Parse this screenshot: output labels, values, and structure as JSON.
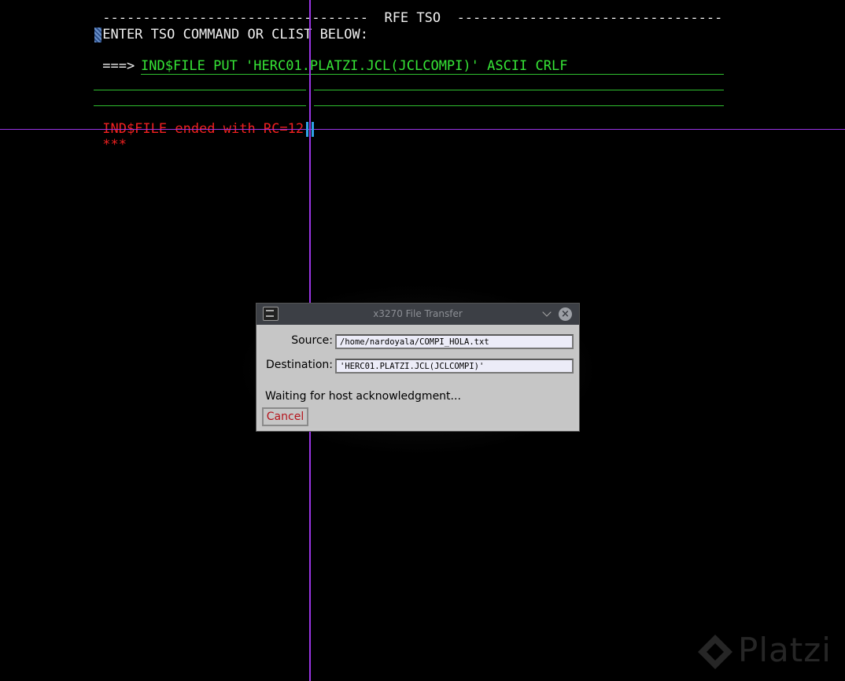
{
  "terminal": {
    "header_line": " ---------------------------------  RFE TSO  ---------------------------------",
    "prompt_line": " ENTER TSO COMMAND OR CLIST BELOW:",
    "arrow": " ===> ",
    "command": "IND$FILE PUT 'HERC01.PLATZI.JCL(JCLCOMPI)' ASCII CRLF",
    "message": " IND$FILE ended with RC=12",
    "asterisks": " ***"
  },
  "dialog": {
    "title": "x3270 File Transfer",
    "source_label": "Source:",
    "source_value": "/home/nardoyala/COMPI_HOLA.txt",
    "destination_label": "Destination:",
    "destination_value": "'HERC01.PLATZI.JCL(JCLCOMPI)'",
    "status": "Waiting for host acknowledgment...",
    "cancel_label": "Cancel"
  },
  "watermark": {
    "brand": "Platzi"
  },
  "colors": {
    "terminal_bg": "#000000",
    "terminal_green": "#36e436",
    "terminal_red": "#f02020",
    "crosshair": "#9a35e6",
    "cursor": "#2ea3e6"
  }
}
